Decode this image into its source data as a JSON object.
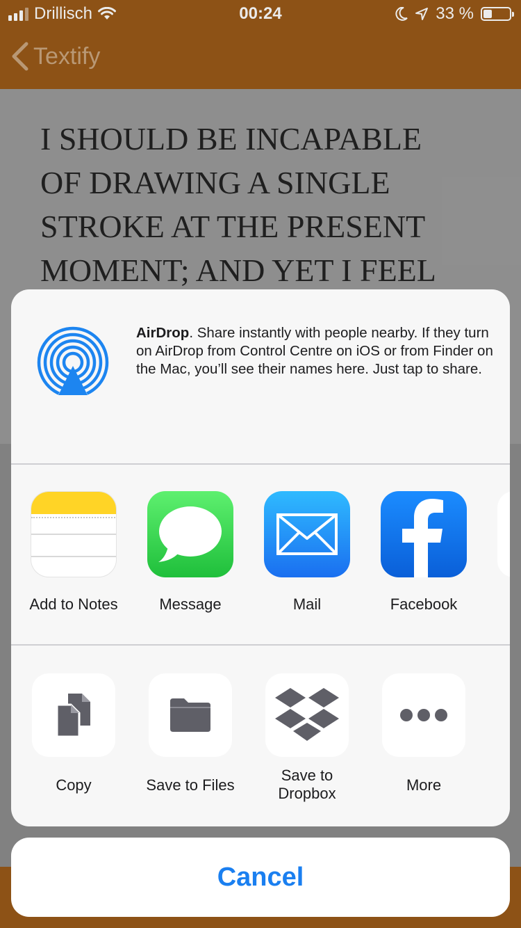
{
  "status_bar": {
    "carrier": "Drillisch",
    "time": "00:24",
    "battery": "33 %",
    "battery_level": 0.33
  },
  "nav": {
    "back_label": "Textify"
  },
  "photo_text": "I SHOULD BE INCAPABLE\nOF DRAWING A SINGLE\nSTROKE AT THE PRESENT\nMOMENT; AND YET I FEEL",
  "airdrop": {
    "title": "AirDrop",
    "description": ". Share instantly with people nearby. If they turn on AirDrop from Control Centre on iOS or from Finder on the Mac, you’ll see their names here. Just tap to share."
  },
  "apps": [
    {
      "label": "Add to Notes",
      "icon": "notes-icon"
    },
    {
      "label": "Message",
      "icon": "messages-icon"
    },
    {
      "label": "Mail",
      "icon": "mail-icon"
    },
    {
      "label": "Facebook",
      "icon": "facebook-icon"
    }
  ],
  "actions": [
    {
      "label": "Copy",
      "icon": "copy-icon"
    },
    {
      "label": "Save to Files",
      "icon": "folder-icon"
    },
    {
      "label": "Save to Dropbox",
      "icon": "dropbox-icon"
    },
    {
      "label": "More",
      "icon": "more-icon"
    }
  ],
  "cancel_label": "Cancel",
  "colors": {
    "app_bar": "#9a5a18",
    "accent": "#1a7ff0",
    "messages_green": "#2dc84a",
    "mail_blue": "#1e8ff5",
    "facebook_blue": "#1877f2",
    "notes_yellow": "#ffd426",
    "action_glyph": "#5f5f67"
  }
}
